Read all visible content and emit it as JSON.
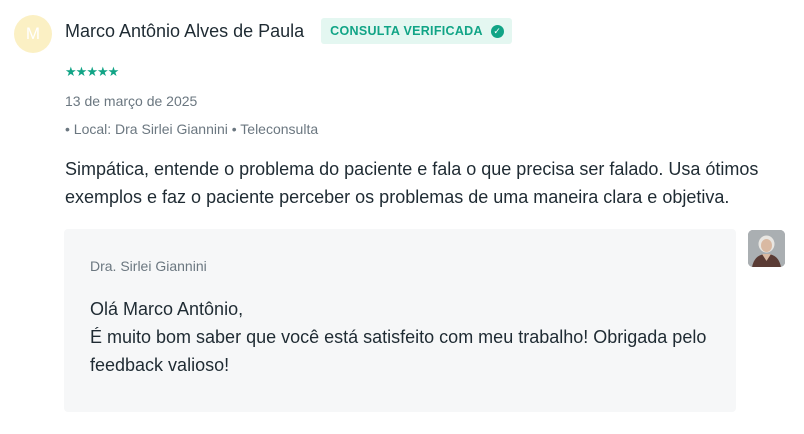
{
  "review": {
    "avatar_initial": "M",
    "author_name": "Marco Antônio Alves de Paula",
    "badge_label": "CONSULTA VERIFICADA",
    "rating": 5,
    "rating_max": 5,
    "date": "13 de março de 2025",
    "meta": "• Local: Dra Sirlei Giannini • Teleconsulta",
    "text": "Simpática, entende o problema do paciente e fala o que precisa ser falado. Usa ótimos exemplos e faz o paciente perceber os problemas de uma maneira clara e objetiva."
  },
  "reply": {
    "author": "Dra. Sirlei Giannini",
    "greeting": "Olá Marco Antônio,",
    "body": "É muito bom saber que você está satisfeito com meu trabalho! Obrigada pelo feedback valioso!"
  },
  "colors": {
    "accent": "#11a486",
    "badge_bg": "#e4f7f1",
    "avatar_bg": "#fbf0c4",
    "reply_bg": "#f6f7f8"
  }
}
